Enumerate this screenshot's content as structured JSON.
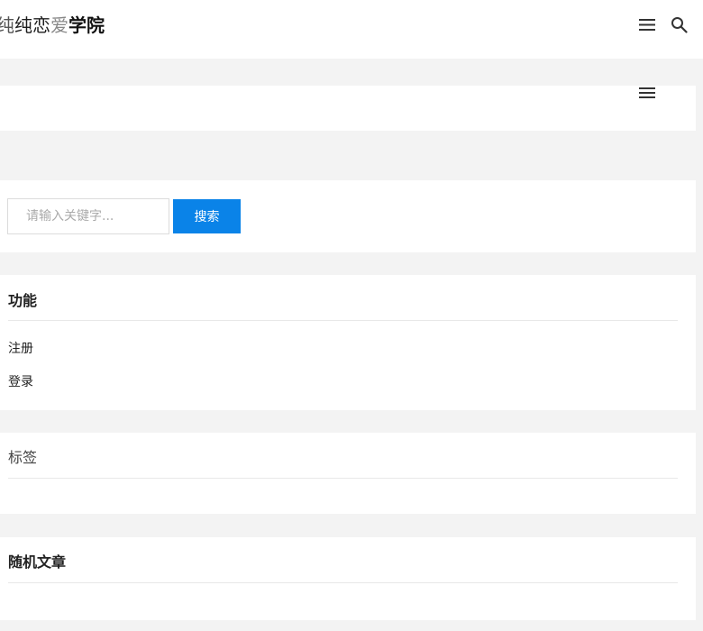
{
  "header": {
    "title_parts": [
      "纯",
      "纯",
      "恋",
      "爱",
      "学院"
    ],
    "menu_icon": "hamburger-menu-icon",
    "search_icon": "magnifier-search-icon"
  },
  "nav_panel": {
    "menu_icon": "hamburger-menu-icon"
  },
  "search": {
    "placeholder": "请输入关键字...",
    "value": "",
    "button_label": "搜索",
    "button_color": "#0a83e8"
  },
  "widgets": {
    "functions": {
      "title": "功能",
      "links": [
        "注册",
        "登录"
      ]
    },
    "tags": {
      "title": "标签"
    },
    "random_posts": {
      "title": "随机文章"
    }
  },
  "colors": {
    "page_background": "#f3f3f3",
    "panel_background": "#ffffff",
    "accent": "#0a83e8"
  }
}
